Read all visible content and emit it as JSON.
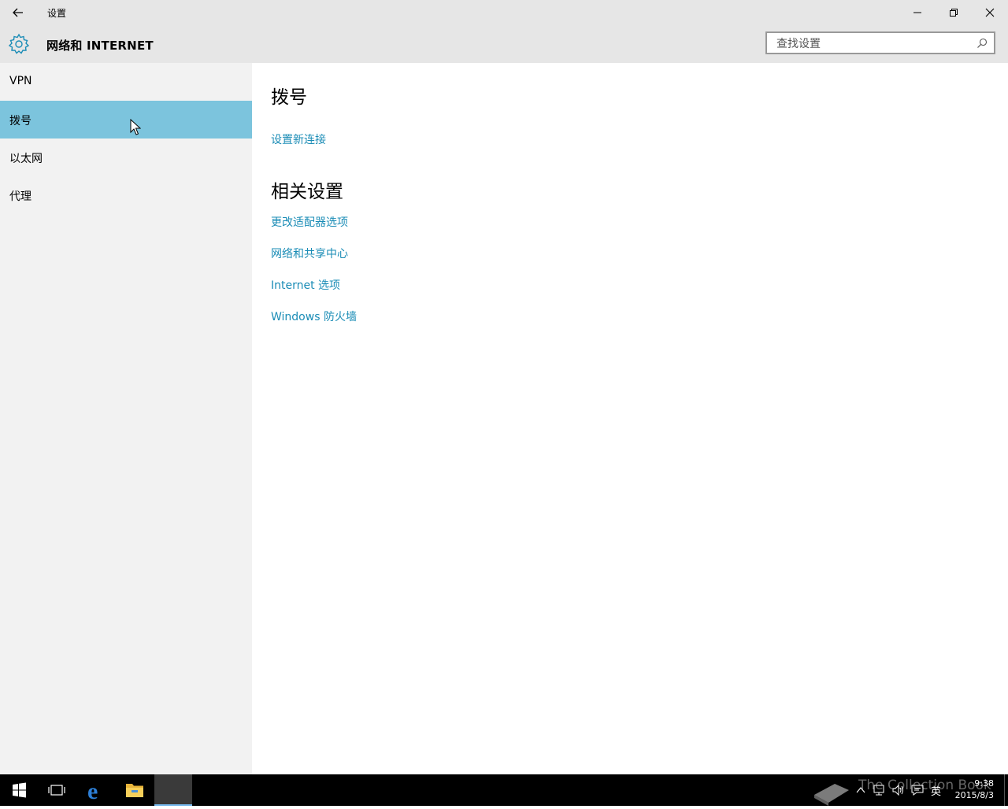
{
  "window": {
    "title": "设置"
  },
  "header": {
    "page_title": "网络和 INTERNET",
    "search_placeholder": "查找设置"
  },
  "sidebar": {
    "items": [
      {
        "label": "VPN",
        "selected": false
      },
      {
        "label": "拨号",
        "selected": true
      },
      {
        "label": "以太网",
        "selected": false
      },
      {
        "label": "代理",
        "selected": false
      }
    ]
  },
  "content": {
    "heading": "拨号",
    "setup_link": "设置新连接",
    "related_heading": "相关设置",
    "related_links": [
      "更改适配器选项",
      "网络和共享中心",
      "Internet 选项",
      "Windows 防火墙"
    ]
  },
  "taskbar": {
    "watermark": "The Collection Book",
    "ime": "英",
    "time": "9:38",
    "date": "2015/8/3"
  },
  "colors": {
    "accent": "#7cc4dd",
    "link": "#1a8cb6",
    "chrome": "#e6e6e6",
    "sidebar": "#f2f2f2"
  }
}
